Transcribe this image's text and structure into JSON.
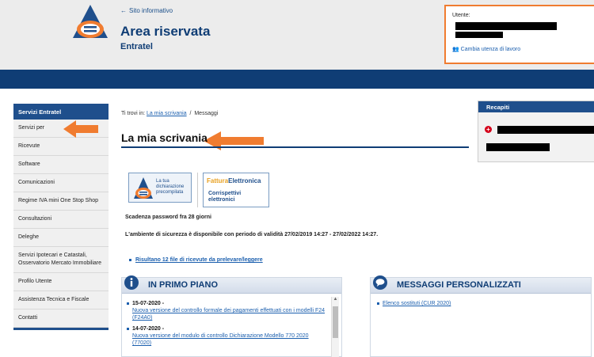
{
  "header": {
    "back_link": "Sito informativo",
    "title": "Area riservata",
    "subtitle": "Entratel",
    "user_label": "Utente:",
    "change_user": "Cambia utenza di lavoro"
  },
  "sidebar": {
    "title": "Servizi Entratel",
    "items": [
      {
        "label": "Servizi per"
      },
      {
        "label": "Ricevute"
      },
      {
        "label": "Software"
      },
      {
        "label": "Comunicazioni"
      },
      {
        "label": "Regime IVA mini One Stop Shop"
      },
      {
        "label": "Consultazioni"
      },
      {
        "label": "Deleghe"
      },
      {
        "label": "Servizi Ipotecari e Catastali, Osservatorio Mercato Immobiliare"
      },
      {
        "label": "Profilo Utente"
      },
      {
        "label": "Assistenza Tecnica e Fiscale"
      },
      {
        "label": "Contatti"
      }
    ]
  },
  "breadcrumb": {
    "prefix": "Ti trovi in:",
    "link": "La mia scrivania",
    "separator": "/",
    "current": "Messaggi"
  },
  "main": {
    "title": "La mia scrivania",
    "banner1_text": "La tua dichiarazione precompilata",
    "banner2_line1_a": "Fattura",
    "banner2_line1_b": "Elettronica",
    "banner2_line2_a": "Corrispettivi",
    "banner2_line2_b": "elettronici",
    "password_msg": "Scadenza password fra 28 giorni",
    "env_msg": "L'ambiente di sicurezza è disponibile con periodo di validità 27/02/2019 14:27 - 27/02/2022 14:27.",
    "receipts_link": "Risultano 12 file di ricevute da prelevare/leggere"
  },
  "news_panel": {
    "title": "IN PRIMO PIANO",
    "items": [
      {
        "date": "15-07-2020 -",
        "text": "Nuova versione del controllo formale dei pagamenti effettuati con i modelli F24 (F24A0)"
      },
      {
        "date": "14-07-2020 -",
        "text": "Nuova versione del modulo di controllo Dichiarazione Modello 770 2020 (77020)"
      }
    ]
  },
  "messages_panel": {
    "title": "MESSAGGI PERSONALIZZATI",
    "items": [
      {
        "text": "Elenco sostituti (CUR 2020)"
      }
    ]
  },
  "recapiti": {
    "title": "Recapiti"
  },
  "colors": {
    "brand_blue": "#0f3d75",
    "accent_orange": "#f07c30",
    "link_blue": "#1b5fae"
  }
}
